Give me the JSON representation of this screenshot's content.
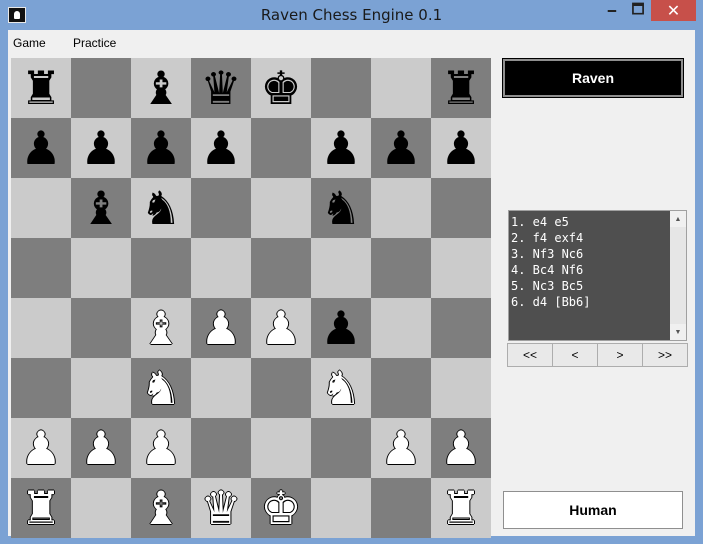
{
  "window": {
    "title": "Raven Chess Engine 0.1",
    "controls": {
      "minimize": "🗕",
      "maximize": "🗖",
      "close": "✕"
    }
  },
  "menu": [
    "Game",
    "Practice"
  ],
  "board": {
    "rows": [
      [
        "r",
        "",
        "b",
        "q",
        "k",
        "",
        "",
        "r"
      ],
      [
        "p",
        "p",
        "p",
        "p",
        "",
        "p",
        "p",
        "p"
      ],
      [
        "",
        "b",
        "n",
        "",
        "",
        "n",
        "",
        ""
      ],
      [
        "",
        "",
        "",
        "",
        "",
        "",
        "",
        ""
      ],
      [
        "",
        "",
        "B",
        "P",
        "P",
        "p",
        "",
        ""
      ],
      [
        "",
        "",
        "N",
        "",
        "",
        "N",
        "",
        ""
      ],
      [
        "P",
        "P",
        "P",
        "",
        "",
        "",
        "P",
        "P"
      ],
      [
        "R",
        "",
        "B",
        "Q",
        "K",
        "",
        "",
        "R"
      ]
    ],
    "colors": {
      "light": "#cbcbcb",
      "dark": "#7e7e7e"
    }
  },
  "players": {
    "engine": "Raven",
    "human": "Human"
  },
  "moves": [
    "1. e4 e5",
    "2. f4 exf4",
    "3. Nf3 Nc6",
    "4. Bc4 Nf6",
    "5. Nc3 Bc5",
    "6. d4 [Bb6]"
  ],
  "nav_buttons": [
    "<<",
    "<",
    ">",
    ">>"
  ]
}
